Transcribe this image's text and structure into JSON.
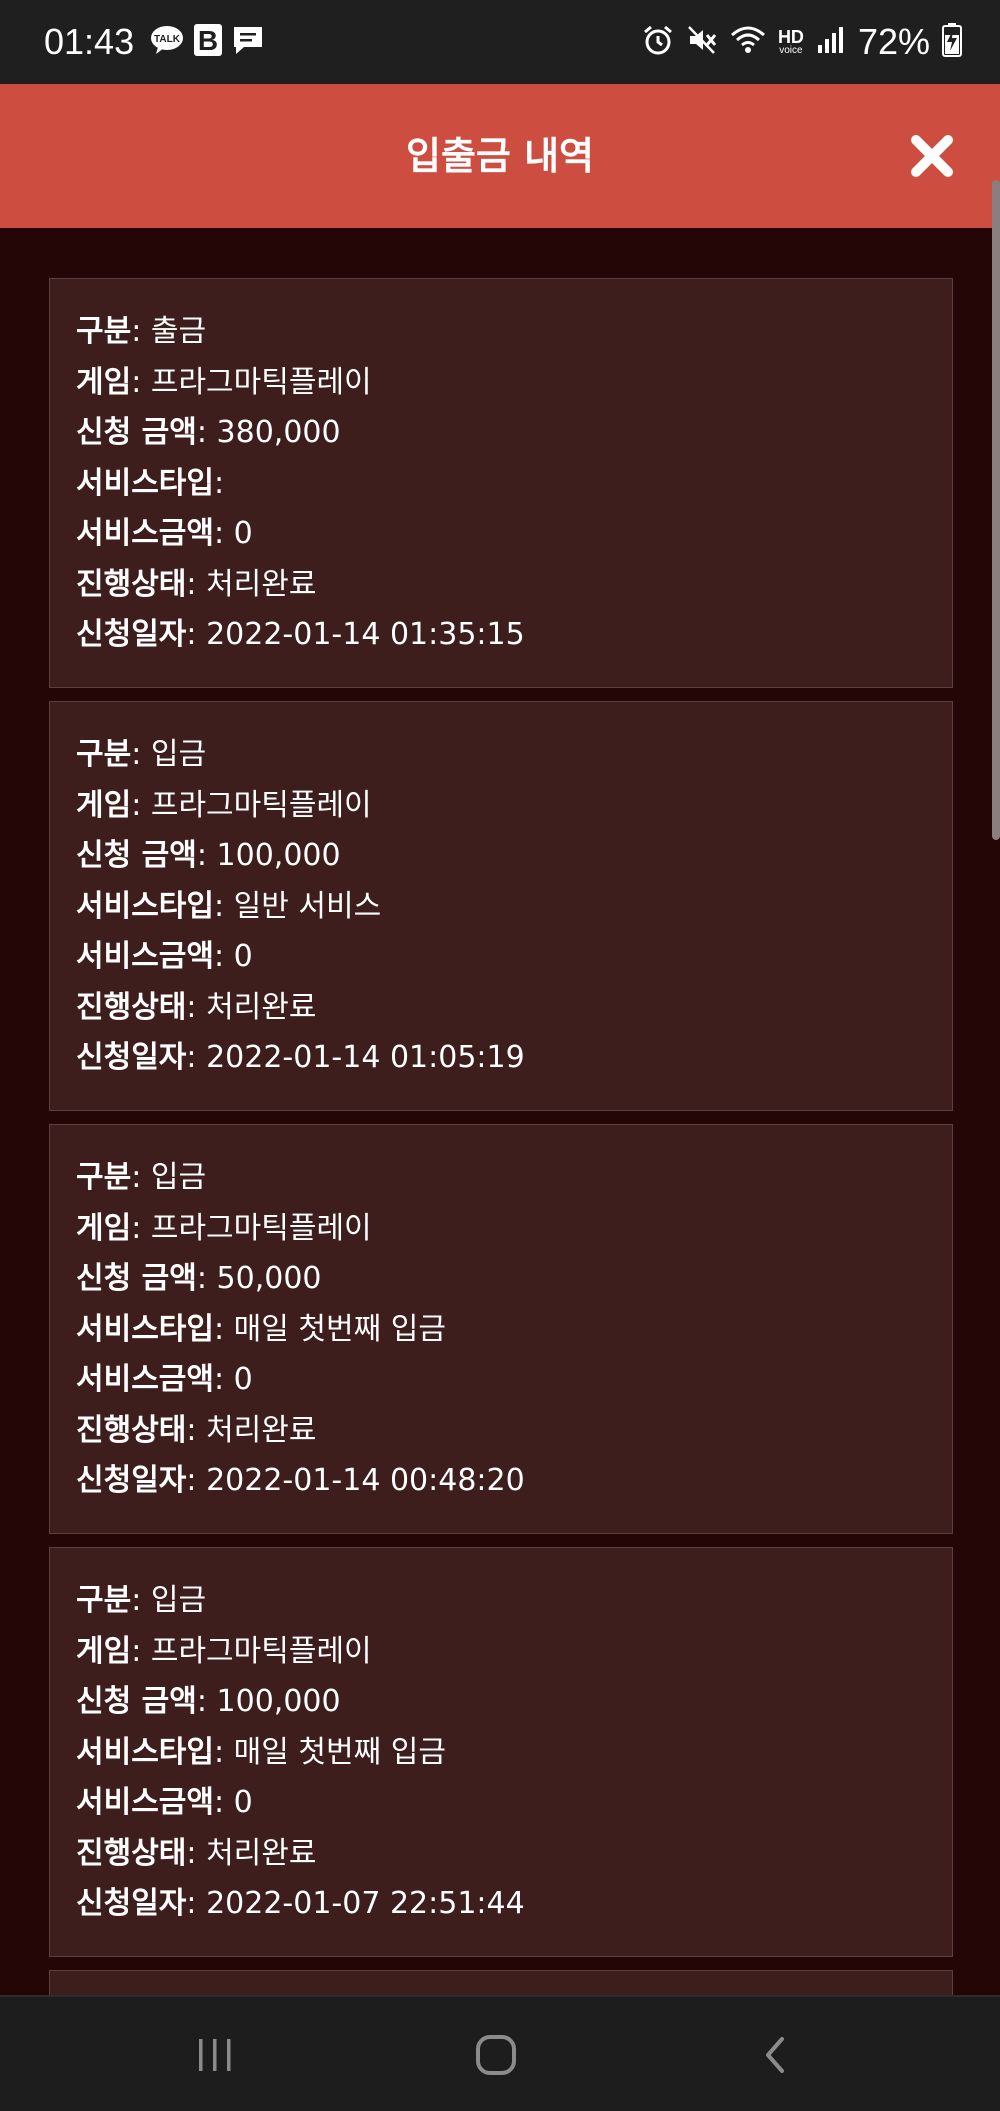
{
  "status_bar": {
    "time": "01:43",
    "talk_label": "TALK",
    "b_label": "B",
    "hd_label": "HD",
    "voice_label": "voice",
    "battery": "72%"
  },
  "header": {
    "title": "입출금 내역"
  },
  "labels": {
    "type": "구분",
    "game": "게임",
    "amount": "신청 금액",
    "service_type": "서비스타입",
    "service_amount": "서비스금액",
    "status": "진행상태",
    "date": "신청일자"
  },
  "separator": ": ",
  "transactions": [
    {
      "type": "출금",
      "game": "프라그마틱플레이",
      "amount": "380,000",
      "service_type": "",
      "service_amount": "0",
      "status": "처리완료",
      "date": "2022-01-14 01:35:15"
    },
    {
      "type": "입금",
      "game": "프라그마틱플레이",
      "amount": "100,000",
      "service_type": "일반 서비스",
      "service_amount": "0",
      "status": "처리완료",
      "date": "2022-01-14 01:05:19"
    },
    {
      "type": "입금",
      "game": "프라그마틱플레이",
      "amount": "50,000",
      "service_type": "매일 첫번째 입금",
      "service_amount": "0",
      "status": "처리완료",
      "date": "2022-01-14 00:48:20"
    },
    {
      "type": "입금",
      "game": "프라그마틱플레이",
      "amount": "100,000",
      "service_type": "매일 첫번째 입금",
      "service_amount": "0",
      "status": "처리완료",
      "date": "2022-01-07 22:51:44"
    }
  ],
  "colors": {
    "header": "#cd4e40",
    "background": "#230605",
    "card": "#3d1e1d",
    "status_bar": "#1f1f1f"
  },
  "icons": {
    "close": "close-icon",
    "alarm": "alarm-icon",
    "mute": "mute-icon",
    "wifi": "wifi-icon",
    "signal": "signal-icon",
    "battery": "battery-charging-icon",
    "recent_apps": "recent-apps-icon",
    "home": "home-icon",
    "back": "back-icon"
  }
}
